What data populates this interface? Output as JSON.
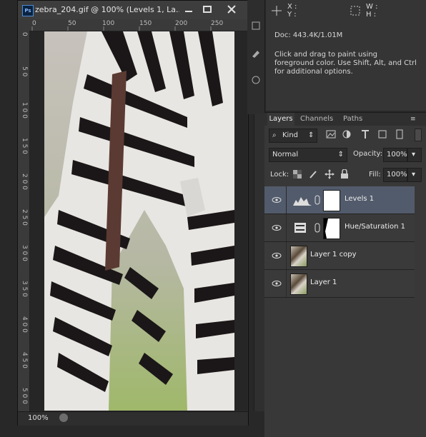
{
  "document": {
    "ps_badge": "Ps",
    "title": "zebra_204.gif @ 100% (Levels 1, La...",
    "zoom": "100%",
    "ruler_top": [
      "0",
      "50",
      "100",
      "150",
      "200",
      "250"
    ],
    "ruler_left": [
      "0",
      "5 0",
      "1 0 0",
      "1 5 0",
      "2 0 0",
      "2 5 0",
      "3 0 0",
      "3 5 0",
      "4 0 0",
      "4 5 0",
      "5 0 0"
    ]
  },
  "info": {
    "x_label": "X :",
    "y_label": "Y :",
    "w_label": "W :",
    "h_label": "H :",
    "doc": "Doc: 443.4K/1.01M",
    "hint": "Click and drag to paint using foreground color.  Use Shift, Alt, and Ctrl for additional options."
  },
  "layers_panel": {
    "tabs": [
      "Layers",
      "Channels",
      "Paths"
    ],
    "kind_label": "Kind",
    "blend_mode": "Normal",
    "opacity_label": "Opacity:",
    "opacity_value": "100%",
    "lock_label": "Lock:",
    "fill_label": "Fill:",
    "fill_value": "100%",
    "layers": [
      {
        "name": "Levels 1",
        "type": "adjustment-levels",
        "selected": true
      },
      {
        "name": "Hue/Saturation 1",
        "type": "adjustment-hue",
        "selected": false
      },
      {
        "name": "Layer 1 copy",
        "type": "image",
        "selected": false
      },
      {
        "name": "Layer 1",
        "type": "image",
        "selected": false
      }
    ]
  },
  "colors": {
    "selected_row": "#525b6b",
    "panel_bg": "#383838",
    "app_bg": "#282828"
  }
}
